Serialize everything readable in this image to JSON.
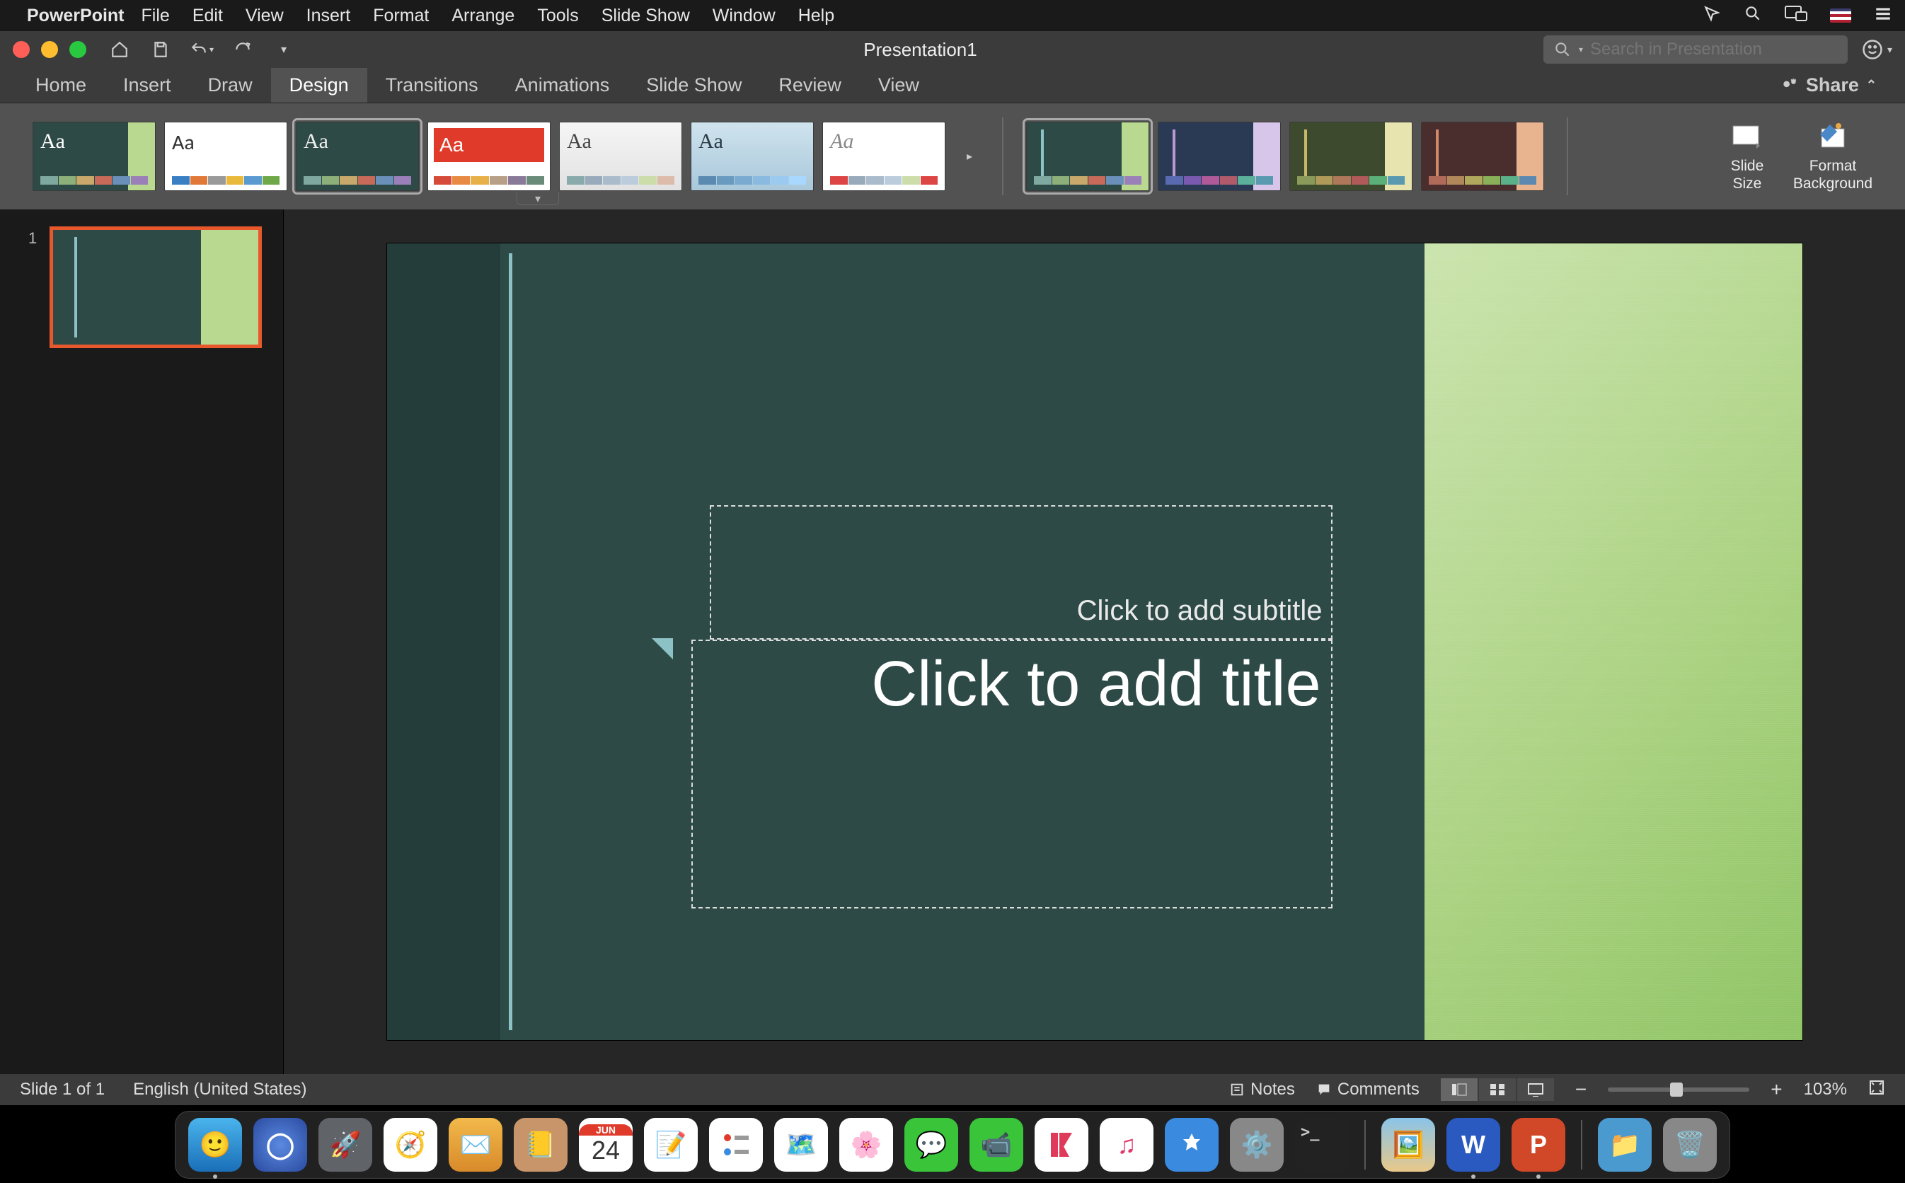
{
  "menubar": {
    "app_name": "PowerPoint",
    "items": [
      "File",
      "Edit",
      "View",
      "Insert",
      "Format",
      "Arrange",
      "Tools",
      "Slide Show",
      "Window",
      "Help"
    ]
  },
  "titlebar": {
    "document_title": "Presentation1",
    "search_placeholder": "Search in Presentation"
  },
  "ribbon": {
    "tabs": [
      "Home",
      "Insert",
      "Draw",
      "Design",
      "Transitions",
      "Animations",
      "Slide Show",
      "Review",
      "View"
    ],
    "active_tab": "Design",
    "share_label": "Share",
    "slide_size_label": "Slide\nSize",
    "format_bg_label": "Format\nBackground"
  },
  "slidenav": {
    "slides": [
      {
        "number": "1"
      }
    ]
  },
  "slide": {
    "title_placeholder": "Click to add title",
    "subtitle_placeholder": "Click to add subtitle"
  },
  "statusbar": {
    "slide_info": "Slide 1 of 1",
    "language": "English (United States)",
    "notes_label": "Notes",
    "comments_label": "Comments",
    "zoom_pct": "103%"
  },
  "dock": {
    "date": {
      "month": "JUN",
      "day": "24"
    },
    "apps": [
      "finder",
      "siri",
      "launchpad",
      "safari",
      "mail",
      "contacts",
      "calendar",
      "notes",
      "reminders",
      "maps",
      "photos",
      "messages",
      "facetime",
      "news",
      "music",
      "appstore",
      "settings",
      "terminal"
    ],
    "right_apps": [
      "pictures",
      "word",
      "powerpoint"
    ],
    "far_apps": [
      "downloads",
      "trash"
    ]
  }
}
